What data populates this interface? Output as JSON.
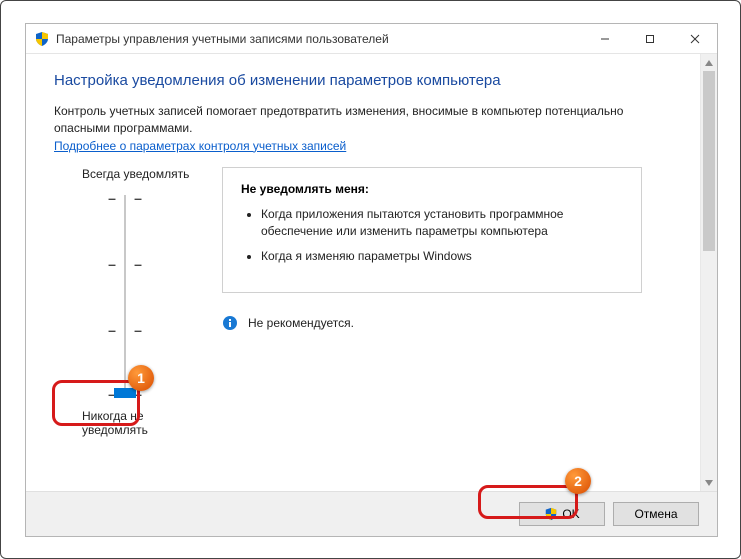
{
  "window": {
    "title": "Параметры управления учетными записями пользователей"
  },
  "heading": "Настройка уведомления об изменении параметров компьютера",
  "intro": "Контроль учетных записей помогает предотвратить изменения, вносимые в компьютер потенциально опасными программами.",
  "link": "Подробнее о параметрах контроля учетных записей",
  "slider": {
    "top_label": "Всегда уведомлять",
    "bottom_label": "Никогда не уведомлять",
    "levels": 4,
    "current_level": 0
  },
  "description": {
    "title": "Не уведомлять меня:",
    "bullets": [
      "Когда приложения пытаются установить программное обеспечение или изменить параметры компьютера",
      "Когда я изменяю параметры Windows"
    ],
    "info": "Не рекомендуется."
  },
  "buttons": {
    "ok": "OK",
    "cancel": "Отмена"
  },
  "annotations": {
    "badge1": "1",
    "badge2": "2"
  }
}
